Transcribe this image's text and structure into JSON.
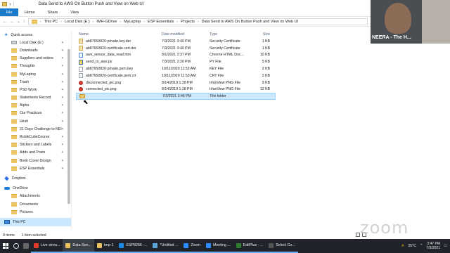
{
  "window": {
    "title": "Data Send to AWS On Button Push and View on Web UI"
  },
  "ribbon": {
    "file": "File",
    "tabs": [
      "Home",
      "Share",
      "View"
    ]
  },
  "breadcrumb": [
    "This PC",
    "Local Disk (E:)",
    "IMH-GDrive",
    "MyLaptop",
    "ESP Essentials",
    "Projects",
    "Data Send to AWS On Button Push and View on Web UI"
  ],
  "nav": {
    "quick_access": "Quick access",
    "items": [
      "Local Disk (E:)",
      "Downloads",
      "Suppliers and orders",
      "Thoughts",
      "MyLaptop",
      "Trash",
      "PSD Work",
      "Statements Record",
      "Alpha",
      "Our Practices",
      "Hindi",
      "21 Days Challenge to NEI",
      "RubikCubeCourse",
      "Stickers and Labels",
      "Adds and Posts",
      "Book Cover Design",
      "ESP Essentials"
    ],
    "dropbox": "Dropbox",
    "onedrive": "OneDrive",
    "onedrive_items": [
      "Attachments",
      "Documents",
      "Pictures"
    ],
    "this_pc": "This PC"
  },
  "columns": {
    "name": "Name",
    "date": "Date modified",
    "type": "Type",
    "size": "Size"
  },
  "files": [
    {
      "name": "ab87659820-private.key.der",
      "date": "7/3/2021 3:40 PM",
      "type": "Security Certificate",
      "size": "1 KB",
      "icon": "cert"
    },
    {
      "name": "ab87659820-certificate.cert.der",
      "date": "7/3/2021 3:40 PM",
      "type": "Security Certificate",
      "size": "1 KB",
      "icon": "cert"
    },
    {
      "name": "aws_sensor_data_read.htm",
      "date": "8/1/2021 2:37 PM",
      "type": "Chrome HTML Doc...",
      "size": "10 KB",
      "icon": "html"
    },
    {
      "name": "send_to_aws.py",
      "date": "7/3/2021 2:20 PM",
      "type": "PY File",
      "size": "5 KB",
      "icon": "py"
    },
    {
      "name": "ab87659820-private.pem.key",
      "date": "10/11/2020 11:53 AM",
      "type": "KEY File",
      "size": "2 KB",
      "icon": "doc"
    },
    {
      "name": "ab87659820-certificate.pem.crt",
      "date": "10/11/2020 11:53 AM",
      "type": "CRT File",
      "size": "2 KB",
      "icon": "doc"
    },
    {
      "name": "disconnected_pic.png",
      "date": "8/14/2019 1:28 PM",
      "type": "IrfanView PNG File",
      "size": "9 KB",
      "icon": "img"
    },
    {
      "name": "connected_pic.png",
      "date": "8/14/2019 1:28 PM",
      "type": "IrfanView PNG File",
      "size": "12 KB",
      "icon": "img"
    },
    {
      "name": "",
      "date": "7/3/2021 3:46 PM",
      "type": "File folder",
      "size": "",
      "icon": "fold",
      "selected": true
    }
  ],
  "status": {
    "items": "9 items",
    "selected": "1 item selected"
  },
  "camera": {
    "label": "NEERA - The H..."
  },
  "watermark": "zoom",
  "taskbar": {
    "apps": [
      {
        "label": "Live strea...",
        "color": "#e0402a"
      },
      {
        "label": "Data Sen...",
        "color": "#e8c15a",
        "active": true
      },
      {
        "label": "tmp-1",
        "color": "#e8c15a"
      },
      {
        "label": "ESP8266 -...",
        "color": "#1e88e5"
      },
      {
        "label": "*Untitled ...",
        "color": "#5ba4d9"
      },
      {
        "label": "Zoom",
        "color": "#2d8cff"
      },
      {
        "label": "Meeting ...",
        "color": "#2d8cff"
      },
      {
        "label": "EditPlus - ...",
        "color": "#2e7d32"
      },
      {
        "label": "Select Co...",
        "color": "#333"
      }
    ],
    "temp": "35°C",
    "time": "3:47 PM",
    "date": "7/3/2021"
  }
}
